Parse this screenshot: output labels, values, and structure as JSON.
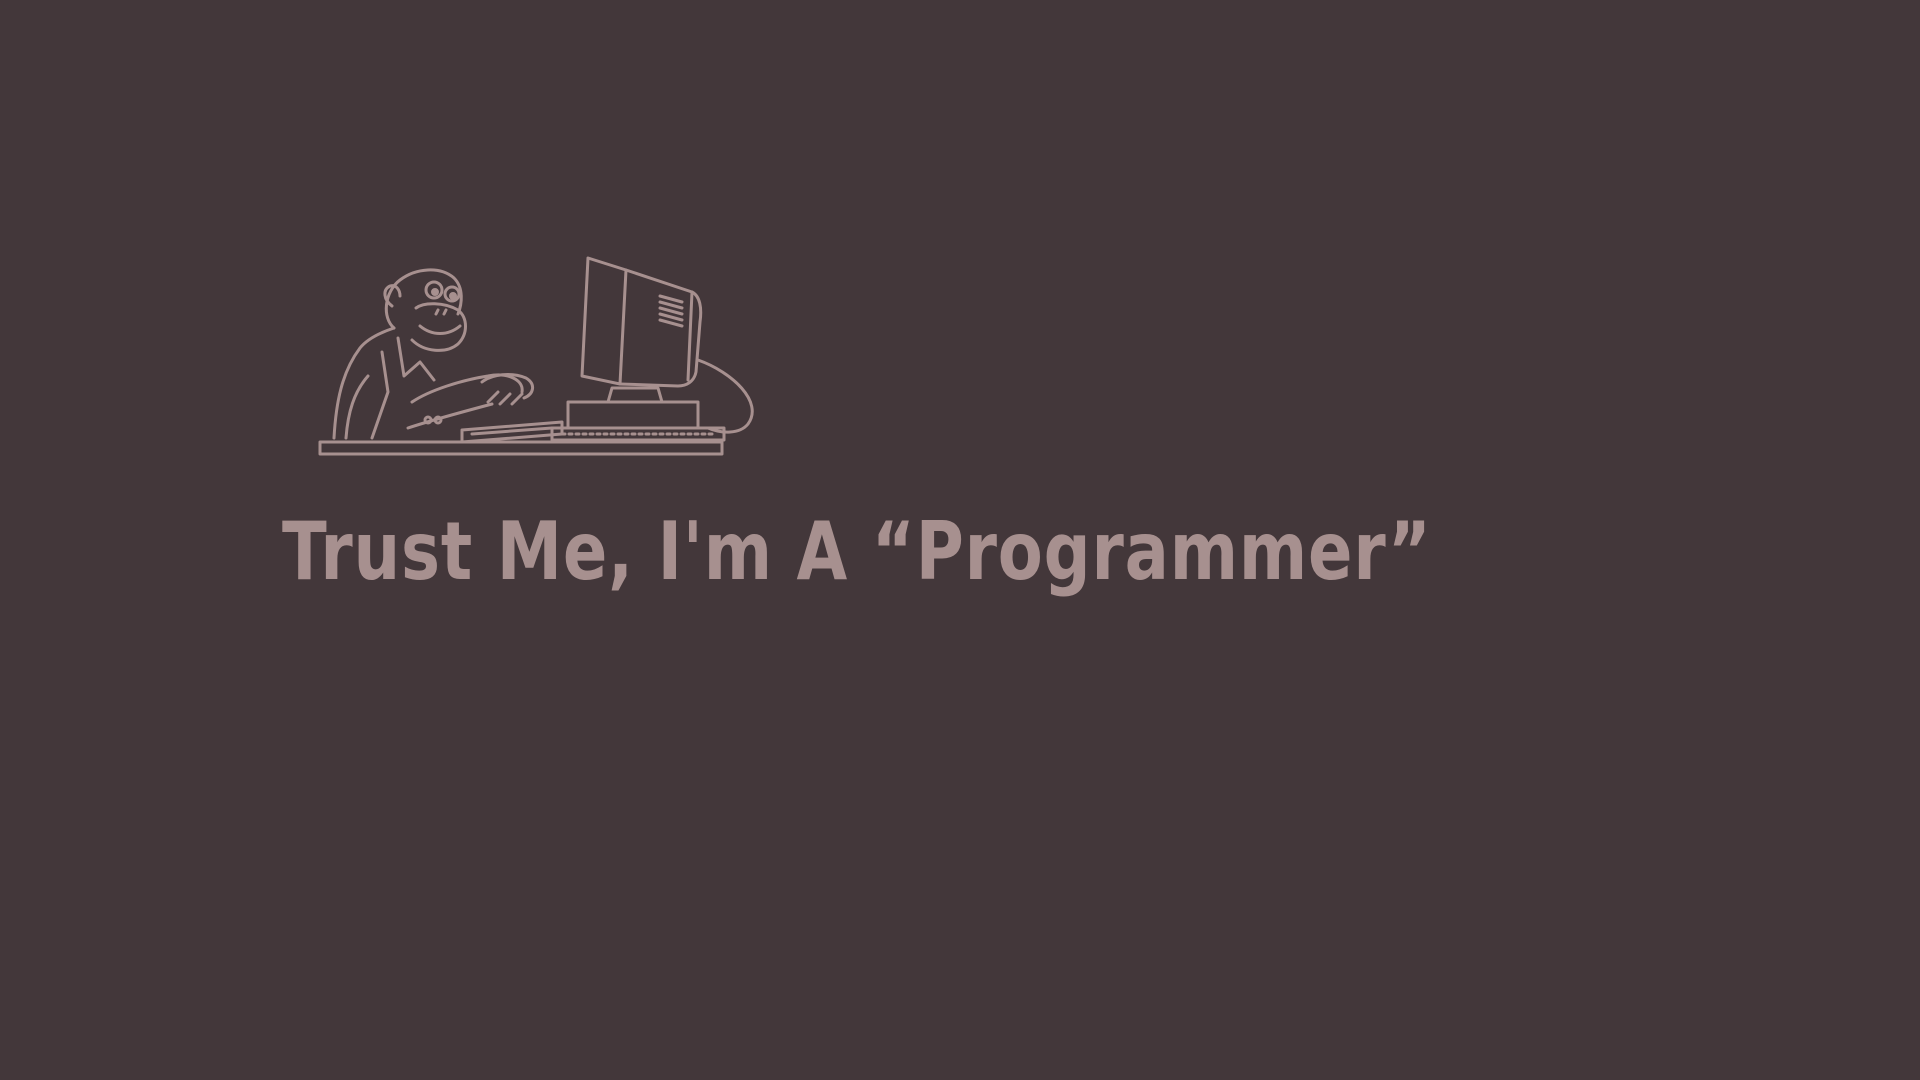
{
  "background_color": "#43373a",
  "accent_color": "#a7908f",
  "illustration": {
    "icon": "monkey-at-computer-icon"
  },
  "tagline": {
    "text": "Trust Me, I'm A “Programmer”"
  }
}
